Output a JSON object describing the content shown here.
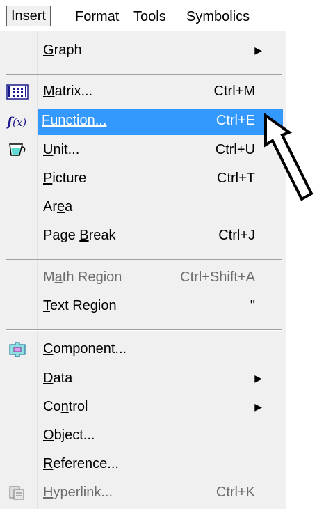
{
  "menubar": {
    "insert": "Insert",
    "format": "Format",
    "tools": "Tools",
    "symbolics": "Symbolics"
  },
  "menu": {
    "graph": {
      "pre": "",
      "ul": "G",
      "post": "raph"
    },
    "matrix": {
      "pre": "",
      "ul": "M",
      "post": "atrix...",
      "shortcut": "Ctrl+M"
    },
    "function": {
      "label": "Function...",
      "shortcut": "Ctrl+E"
    },
    "unit": {
      "pre": "",
      "ul": "U",
      "post": "nit...",
      "shortcut": "Ctrl+U"
    },
    "picture": {
      "pre": "",
      "ul": "P",
      "post": "icture",
      "shortcut": "Ctrl+T"
    },
    "area": {
      "pre": "Ar",
      "ul": "e",
      "post": "a"
    },
    "page_break": {
      "pre": "Page ",
      "ul": "B",
      "post": "reak",
      "shortcut": "Ctrl+J"
    },
    "math_region": {
      "pre": "M",
      "ul": "a",
      "post": "th Region",
      "shortcut": "Ctrl+Shift+A"
    },
    "text_region": {
      "pre": "",
      "ul": "T",
      "post": "ext Region",
      "shortcut": "\""
    },
    "component": {
      "pre": "",
      "ul": "C",
      "post": "omponent..."
    },
    "data": {
      "pre": "",
      "ul": "D",
      "post": "ata"
    },
    "control": {
      "pre": "Co",
      "ul": "n",
      "post": "trol"
    },
    "object": {
      "pre": "",
      "ul": "O",
      "post": "bject..."
    },
    "reference": {
      "pre": "",
      "ul": "R",
      "post": "eference..."
    },
    "hyperlink": {
      "pre": "",
      "ul": "H",
      "post": "yperlink...",
      "shortcut": "Ctrl+K"
    }
  },
  "icons": {
    "matrix": "matrix-icon",
    "function": "function-icon",
    "unit": "unit-icon",
    "component": "component-icon",
    "hyperlink": "hyperlink-icon"
  },
  "colors": {
    "highlight": "#3399ff",
    "menu_bg": "#f0f0f0",
    "disabled_text": "#6d6d6d"
  }
}
